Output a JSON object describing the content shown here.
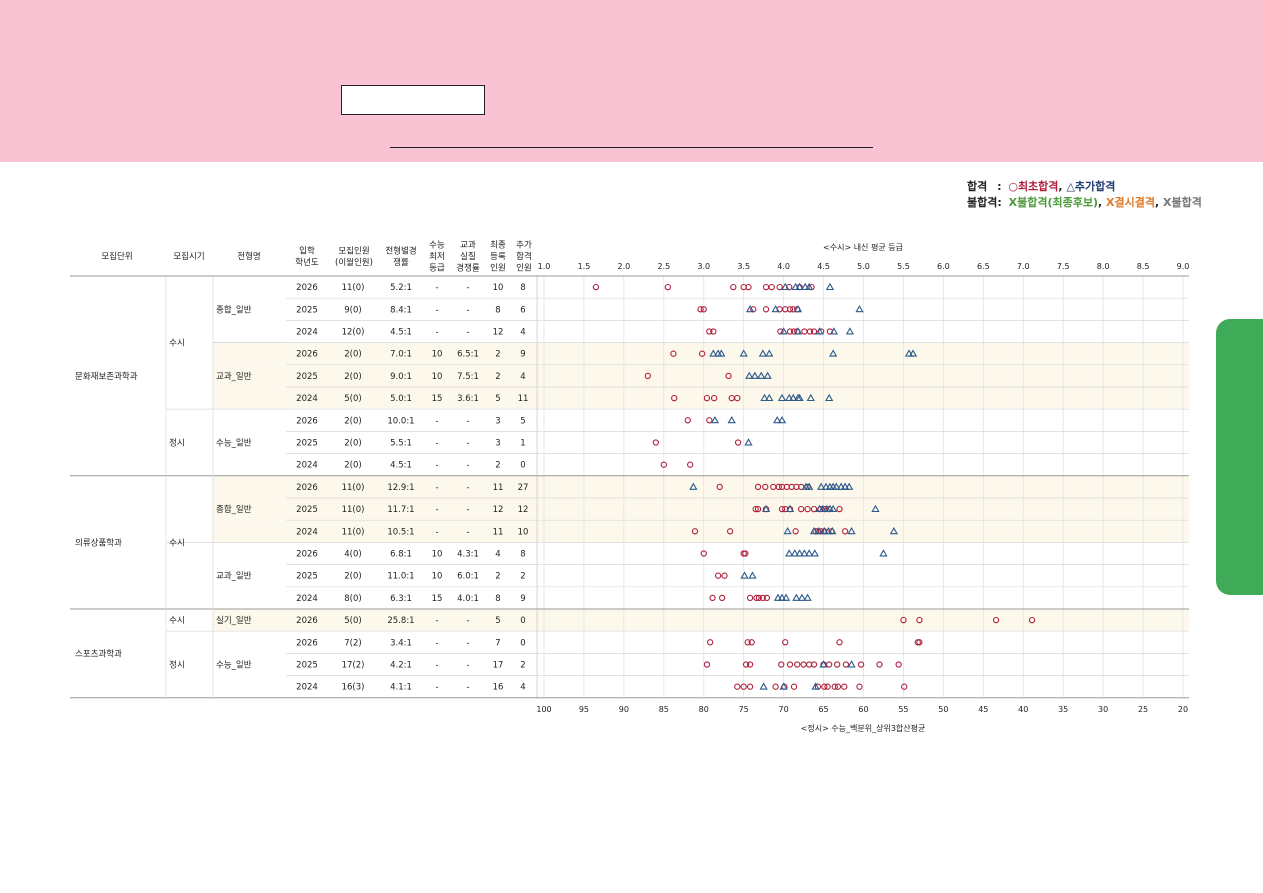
{
  "legend": {
    "pass_label": "합격",
    "pass_sep": ":",
    "first_pass": "○최초합격",
    "extra_pass": "△추가합격",
    "fail_label": "불합격:",
    "waitlist": "X불합격(최종후보)",
    "absent": "X결시결격",
    "fail": "X불합격"
  },
  "headers": {
    "unit": "모집단위",
    "period": "모집시기",
    "type": "전형명",
    "year": [
      "입학",
      "학년도"
    ],
    "quota": [
      "모집인원",
      "(이월인원)"
    ],
    "ratio": [
      "전형별경",
      "쟁률"
    ],
    "csat": [
      "수능",
      "최저",
      "등급"
    ],
    "prac": [
      "교과",
      "실질",
      "경쟁률"
    ],
    "enrolled": [
      "최종",
      "등록",
      "인원"
    ],
    "extra": [
      "추가",
      "합격",
      "인원"
    ]
  },
  "top_axis": {
    "title": "<수시> 내신 평균 등급",
    "ticks": [
      "1.0",
      "1.5",
      "2.0",
      "2.5",
      "3.0",
      "3.5",
      "4.0",
      "4.5",
      "5.0",
      "5.5",
      "6.0",
      "6.5",
      "7.0",
      "7.5",
      "8.0",
      "8.5",
      "9.0"
    ]
  },
  "bottom_axis": {
    "title": "<정시> 수능_백분위_상위3합산평균",
    "ticks": [
      "100",
      "95",
      "90",
      "85",
      "80",
      "75",
      "70",
      "65",
      "60",
      "55",
      "50",
      "45",
      "40",
      "35",
      "30",
      "25",
      "20"
    ]
  },
  "groups": [
    {
      "name": "문화재보존과학과"
    },
    {
      "name": "의류상품학과"
    },
    {
      "name": "스포츠과학과"
    }
  ],
  "periods": [
    {
      "name": "수시"
    },
    {
      "name": "정시"
    },
    {
      "name": "수시"
    },
    {
      "name": "수시"
    },
    {
      "name": "정시"
    }
  ],
  "types": [
    {
      "name": "종합_일반"
    },
    {
      "name": "교과_일반"
    },
    {
      "name": "수능_일반"
    },
    {
      "name": "종합_일반"
    },
    {
      "name": "교과_일반"
    },
    {
      "name": "실기_일반"
    },
    {
      "name": "수능_일반"
    }
  ],
  "rows": [
    {
      "year": "2026",
      "quota": "11(0)",
      "ratio": "5.2:1",
      "csat": "-",
      "prac": "-",
      "enrolled": "10",
      "extra": "8"
    },
    {
      "year": "2025",
      "quota": "9(0)",
      "ratio": "8.4:1",
      "csat": "-",
      "prac": "-",
      "enrolled": "8",
      "extra": "6"
    },
    {
      "year": "2024",
      "quota": "12(0)",
      "ratio": "4.5:1",
      "csat": "-",
      "prac": "-",
      "enrolled": "12",
      "extra": "4"
    },
    {
      "year": "2026",
      "quota": "2(0)",
      "ratio": "7.0:1",
      "csat": "10",
      "prac": "6.5:1",
      "enrolled": "2",
      "extra": "9"
    },
    {
      "year": "2025",
      "quota": "2(0)",
      "ratio": "9.0:1",
      "csat": "10",
      "prac": "7.5:1",
      "enrolled": "2",
      "extra": "4"
    },
    {
      "year": "2024",
      "quota": "5(0)",
      "ratio": "5.0:1",
      "csat": "15",
      "prac": "3.6:1",
      "enrolled": "5",
      "extra": "11"
    },
    {
      "year": "2026",
      "quota": "2(0)",
      "ratio": "10.0:1",
      "csat": "-",
      "prac": "-",
      "enrolled": "3",
      "extra": "5"
    },
    {
      "year": "2025",
      "quota": "2(0)",
      "ratio": "5.5:1",
      "csat": "-",
      "prac": "-",
      "enrolled": "3",
      "extra": "1"
    },
    {
      "year": "2024",
      "quota": "2(0)",
      "ratio": "4.5:1",
      "csat": "-",
      "prac": "-",
      "enrolled": "2",
      "extra": "0"
    },
    {
      "year": "2026",
      "quota": "11(0)",
      "ratio": "12.9:1",
      "csat": "-",
      "prac": "-",
      "enrolled": "11",
      "extra": "27"
    },
    {
      "year": "2025",
      "quota": "11(0)",
      "ratio": "11.7:1",
      "csat": "-",
      "prac": "-",
      "enrolled": "12",
      "extra": "12"
    },
    {
      "year": "2024",
      "quota": "11(0)",
      "ratio": "10.5:1",
      "csat": "-",
      "prac": "-",
      "enrolled": "11",
      "extra": "10"
    },
    {
      "year": "2026",
      "quota": "4(0)",
      "ratio": "6.8:1",
      "csat": "10",
      "prac": "4.3:1",
      "enrolled": "4",
      "extra": "8"
    },
    {
      "year": "2025",
      "quota": "2(0)",
      "ratio": "11.0:1",
      "csat": "10",
      "prac": "6.0:1",
      "enrolled": "2",
      "extra": "2"
    },
    {
      "year": "2024",
      "quota": "8(0)",
      "ratio": "6.3:1",
      "csat": "15",
      "prac": "4.0:1",
      "enrolled": "8",
      "extra": "9"
    },
    {
      "year": "2026",
      "quota": "5(0)",
      "ratio": "25.8:1",
      "csat": "-",
      "prac": "-",
      "enrolled": "5",
      "extra": "0"
    },
    {
      "year": "2026",
      "quota": "7(2)",
      "ratio": "3.4:1",
      "csat": "-",
      "prac": "-",
      "enrolled": "7",
      "extra": "0"
    },
    {
      "year": "2025",
      "quota": "17(2)",
      "ratio": "4.2:1",
      "csat": "-",
      "prac": "-",
      "enrolled": "17",
      "extra": "2"
    },
    {
      "year": "2024",
      "quota": "16(3)",
      "ratio": "4.1:1",
      "csat": "-",
      "prac": "-",
      "enrolled": "16",
      "extra": "4"
    }
  ],
  "colors": {
    "banner": "#f9c3d4",
    "highlight_row": "#fdf8ec",
    "first_pass": "#b01e3a",
    "extra_pass": "#2c5a8a",
    "side_tab": "#3faa58"
  },
  "chart_data": {
    "type": "scatter",
    "series": [
      {
        "name": "최초합격",
        "points_by_row": [
          [
            1.65,
            2.55,
            3.37,
            3.5,
            3.56,
            3.78,
            3.85,
            3.95,
            4.07,
            4.2,
            4.35
          ],
          [
            2.96,
            3.0,
            3.62,
            3.78,
            3.95,
            4.02,
            4.08,
            4.12,
            4.17
          ],
          [
            3.07,
            3.12,
            3.96,
            4.08,
            4.13,
            4.17,
            4.26,
            4.33,
            4.38,
            4.47,
            4.58
          ],
          [
            2.62,
            2.98
          ],
          [
            2.3,
            3.31
          ],
          [
            2.63,
            3.04,
            3.13,
            3.35,
            3.42
          ],
          [
            2.8,
            3.07
          ],
          [
            2.4,
            3.43
          ],
          [
            2.5,
            2.83
          ],
          [
            3.2,
            3.68,
            3.77,
            3.87,
            3.94,
            3.98,
            4.04,
            4.1,
            4.16,
            4.22,
            4.3
          ],
          [
            3.65,
            3.68,
            3.78,
            3.98,
            4.02,
            4.08,
            4.22,
            4.3,
            4.38,
            4.46,
            4.52,
            4.57,
            4.7
          ],
          [
            2.89,
            3.33,
            4.15,
            4.4,
            4.43,
            4.47,
            4.51,
            4.6,
            4.77
          ],
          [
            3.0,
            3.5,
            3.52
          ],
          [
            3.18,
            3.26
          ],
          [
            3.11,
            3.23,
            3.58,
            3.66,
            3.69,
            3.74,
            3.79
          ]
        ],
        "points_by_row_csat": [
          [],
          [],
          [],
          [],
          [],
          [],
          [],
          [],
          [],
          [],
          [],
          [],
          [],
          [],
          [],
          [
            55.0,
            53.0,
            43.4,
            38.9
          ],
          [
            79.2,
            74.5,
            74.0,
            69.8,
            63.0,
            53.2,
            53.0
          ],
          [
            79.6,
            74.7,
            74.2,
            70.3,
            69.2,
            68.3,
            67.5,
            66.8,
            66.2,
            65.0,
            64.3,
            63.3,
            62.2,
            60.3,
            58.0,
            55.6
          ],
          [
            75.8,
            75.0,
            74.2,
            71.0,
            69.9,
            68.7,
            65.7,
            64.9,
            64.5,
            63.6,
            63.2,
            62.4,
            60.5,
            54.9
          ]
        ]
      },
      {
        "name": "추가합격",
        "points_by_row": [
          [
            4.02,
            4.15,
            4.2,
            4.27,
            4.32,
            4.58
          ],
          [
            3.58,
            3.9,
            4.18,
            4.95
          ],
          [
            4.0,
            4.18,
            4.45,
            4.63,
            4.83
          ],
          [
            3.12,
            3.18,
            3.22,
            3.5,
            3.74,
            3.82,
            4.62,
            5.57,
            5.62
          ],
          [
            3.57,
            3.64,
            3.72,
            3.8
          ],
          [
            3.76,
            3.82,
            3.98,
            4.07,
            4.12,
            4.18,
            4.2,
            4.34,
            4.57
          ],
          [
            3.14,
            3.35,
            3.92,
            3.98
          ],
          [
            3.56
          ],
          [],
          [
            2.87,
            4.28,
            4.32,
            4.47,
            4.53,
            4.58,
            4.62,
            4.66,
            4.72,
            4.77,
            4.82
          ],
          [
            3.78,
            4.08,
            4.45,
            4.49,
            4.54,
            4.58,
            4.62,
            5.15
          ],
          [
            4.05,
            4.38,
            4.44,
            4.51,
            4.56,
            4.61,
            4.85,
            5.38
          ],
          [
            4.07,
            4.14,
            4.2,
            4.26,
            4.32,
            4.39,
            5.25
          ],
          [
            3.51,
            3.61
          ],
          [
            3.93,
            3.98,
            4.03,
            4.16,
            4.23,
            4.3
          ]
        ],
        "points_by_row_csat": [
          [],
          [],
          [],
          [],
          [],
          [],
          [],
          [],
          [],
          [],
          [],
          [],
          [],
          [],
          [],
          [],
          [],
          [
            65.0,
            61.5
          ],
          [
            72.5,
            70.0,
            66.0
          ]
        ]
      }
    ],
    "ylim_top_axis": [
      1.0,
      9.0
    ],
    "ylim_bottom_axis": [
      100,
      20
    ]
  }
}
